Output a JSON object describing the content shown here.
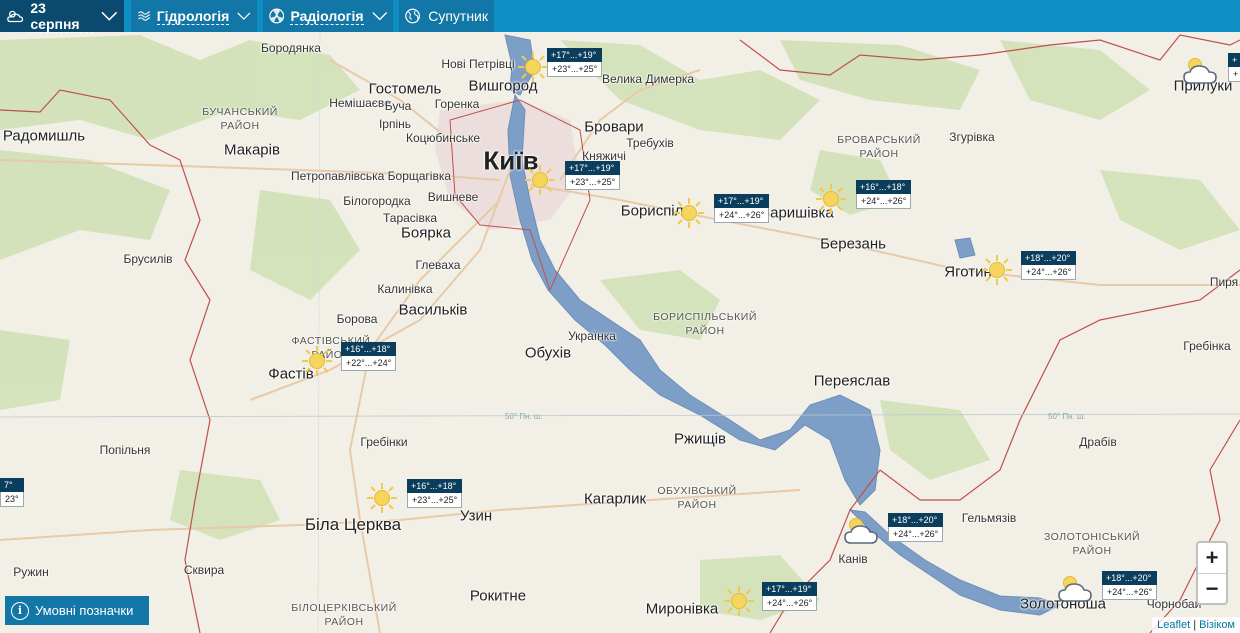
{
  "topbar": {
    "date": "23 серпня",
    "hydrology": "Гідрологія",
    "radiology": "Радіологія",
    "satellite": "Супутник"
  },
  "map": {
    "capital": "Київ",
    "cities": [
      {
        "id": "borodianka",
        "name": "Бородянка"
      },
      {
        "id": "nove-petrivtsi",
        "name": "Нові Петрівці"
      },
      {
        "id": "hostomel",
        "name": "Гостомель"
      },
      {
        "id": "vyshhorod",
        "name": "Вишгород"
      },
      {
        "id": "velyka-dymerka",
        "name": "Велика Димерка"
      },
      {
        "id": "nemishaieve",
        "name": "Немішаєве"
      },
      {
        "id": "bucha",
        "name": "Буча"
      },
      {
        "id": "horenka",
        "name": "Горенка"
      },
      {
        "id": "irpin",
        "name": "Ірпінь"
      },
      {
        "id": "kotsiubynske",
        "name": "Коцюбинське"
      },
      {
        "id": "brovary",
        "name": "Бровари"
      },
      {
        "id": "radomyshl",
        "name": "Радомишль"
      },
      {
        "id": "makariv",
        "name": "Макарів"
      },
      {
        "id": "trebukhiv",
        "name": "Требухів"
      },
      {
        "id": "kniazhychi",
        "name": "Княжичі"
      },
      {
        "id": "zhuravka",
        "name": "Згурівка"
      },
      {
        "id": "petropavlivska",
        "name": "Петропавлівська Борщагівка"
      },
      {
        "id": "vyshneve",
        "name": "Вишневе"
      },
      {
        "id": "boryspil",
        "name": "Бориспіль"
      },
      {
        "id": "baryshivka",
        "name": "Баришівка"
      },
      {
        "id": "bilohorodka",
        "name": "Білогородка"
      },
      {
        "id": "tarasivka",
        "name": "Тарасівка"
      },
      {
        "id": "boiarka",
        "name": "Боярка"
      },
      {
        "id": "berezan",
        "name": "Березань"
      },
      {
        "id": "brusyliv",
        "name": "Брусилів"
      },
      {
        "id": "hlevakha",
        "name": "Глеваха"
      },
      {
        "id": "yahotyn",
        "name": "Яготин"
      },
      {
        "id": "kalynivka",
        "name": "Калинівка"
      },
      {
        "id": "vasylkiv",
        "name": "Васильків"
      },
      {
        "id": "pyriatyn",
        "name": "Пиря"
      },
      {
        "id": "borova",
        "name": "Борова"
      },
      {
        "id": "ukrainka",
        "name": "Українка"
      },
      {
        "id": "hrebinka-e",
        "name": "Гребінка"
      },
      {
        "id": "obukhiv",
        "name": "Обухів"
      },
      {
        "id": "fastiv",
        "name": "Фастів"
      },
      {
        "id": "pereiaslav",
        "name": "Переяслав"
      },
      {
        "id": "rzhyshchiv",
        "name": "Ржищів"
      },
      {
        "id": "hrebinky",
        "name": "Гребінки"
      },
      {
        "id": "drabiv",
        "name": "Драбів"
      },
      {
        "id": "popilnia",
        "name": "Попільня"
      },
      {
        "id": "kaharlyk",
        "name": "Кагарлик"
      },
      {
        "id": "bila-tserkva",
        "name": "Біла Церква"
      },
      {
        "id": "uzyn",
        "name": "Узин"
      },
      {
        "id": "helmiaziv",
        "name": "Гельмязів"
      },
      {
        "id": "kaniv",
        "name": "Канів"
      },
      {
        "id": "ruzhyn",
        "name": "Ружин"
      },
      {
        "id": "skvyra",
        "name": "Сквира"
      },
      {
        "id": "rokytne",
        "name": "Рокитне"
      },
      {
        "id": "myronivka",
        "name": "Миронівка"
      },
      {
        "id": "zolotonosha",
        "name": "Золотоноша"
      },
      {
        "id": "chornobai",
        "name": "Чорнобай"
      },
      {
        "id": "pryluky",
        "name": "Прилуки"
      }
    ],
    "districts": [
      {
        "id": "buchanskyi",
        "name": "БУЧАНСЬКИЙ\nРАЙОН"
      },
      {
        "id": "brovarskyi",
        "name": "БРОВАРСЬКИЙ\nРАЙОН"
      },
      {
        "id": "fastivskyi",
        "name": "ФАСТІВСЬКИЙ\nРАЙОН"
      },
      {
        "id": "boryspilskyi",
        "name": "БОРИСПІЛЬСЬКИЙ\nРАЙОН"
      },
      {
        "id": "obukhivskyi",
        "name": "ОБУХІВСЬКИЙ\nРАЙОН"
      },
      {
        "id": "zolotoniskyi",
        "name": "ЗОЛОТОНІСЬКИЙ\nРАЙОН"
      },
      {
        "id": "bilotserkivskyi",
        "name": "БІЛОЦЕРКІВСЬКИЙ\nРАЙОН"
      }
    ],
    "latitude_label": "50° Пн. ш."
  },
  "weather_markers": [
    {
      "id": "vyshhorod",
      "icon": "sun",
      "night": "+17°...+19°",
      "day": "+23°...+25°"
    },
    {
      "id": "kyiv",
      "icon": "sun",
      "night": "+17°...+19°",
      "day": "+23°...+25°"
    },
    {
      "id": "boryspil",
      "icon": "sun",
      "night": "+17°...+19°",
      "day": "+24°...+26°"
    },
    {
      "id": "baryshivka",
      "icon": "sun",
      "night": "+16°...+18°",
      "day": "+24°...+26°"
    },
    {
      "id": "yahotyn",
      "icon": "sun",
      "night": "+18°...+20°",
      "day": "+24°...+26°"
    },
    {
      "id": "fastiv",
      "icon": "sun",
      "night": "+16°...+18°",
      "day": "+22°...+24°"
    },
    {
      "id": "bila-tserkva",
      "icon": "sun",
      "night": "+16°...+18°",
      "day": "+23°...+25°"
    },
    {
      "id": "kaniv",
      "icon": "cloud-sun",
      "night": "+18°...+20°",
      "day": "+24°...+26°"
    },
    {
      "id": "myronivka",
      "icon": "sun",
      "night": "+17°...+19°",
      "day": "+24°...+26°"
    },
    {
      "id": "zolotonosha",
      "icon": "cloud-sun",
      "night": "+18°...+20°",
      "day": "+24°...+26°"
    }
  ],
  "partial_markers": [
    {
      "id": "west-edge",
      "night": "7°",
      "day": "23°"
    },
    {
      "id": "pryluky",
      "night": "+",
      "day": "+"
    }
  ],
  "controls": {
    "zoom_in": "+",
    "zoom_out": "−",
    "legend": "Умовні позначки"
  },
  "attribution": {
    "leaflet": "Leaflet",
    "separator": "|",
    "source": "Візіком"
  },
  "colors": {
    "topbar": "#0e8fc4",
    "date_bg": "#0b4a6e",
    "water": "#7d9fc7",
    "forest": "#c8dcae",
    "border": "#c0504d"
  }
}
